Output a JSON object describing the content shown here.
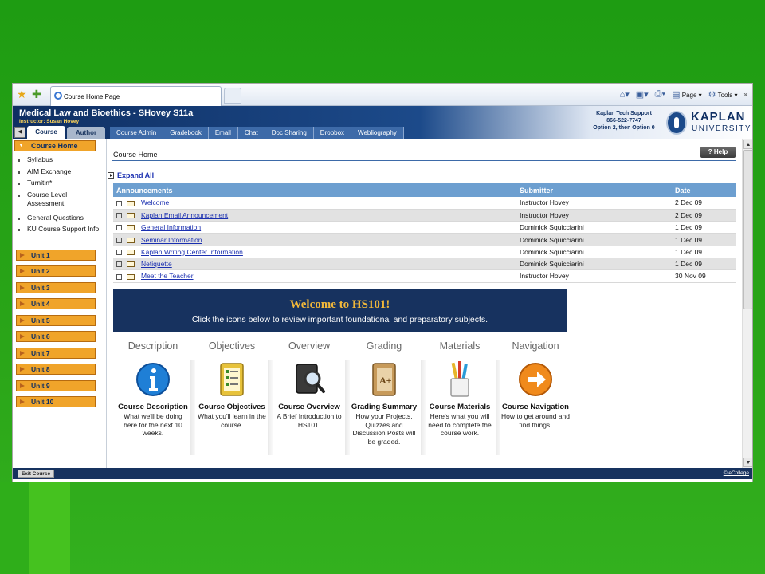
{
  "browser": {
    "tab_title": "Course Home Page",
    "tools": [
      "Page",
      "Tools"
    ]
  },
  "header": {
    "course_title": "Medical Law and Bioethics - SHovey S11a",
    "instructor": "Instructor: Susan Hovey",
    "tabs": [
      "Course",
      "Author"
    ],
    "nav": [
      "Course Admin",
      "Gradebook",
      "Email",
      "Chat",
      "Doc Sharing",
      "Dropbox",
      "Webliography"
    ],
    "support": [
      "Kaplan Tech Support",
      "866-522-7747",
      "Option 2, then Option 0"
    ],
    "logo": [
      "KAPLAN",
      "UNIVERSITY"
    ]
  },
  "sidebar": {
    "header": "Course Home",
    "links": [
      "Syllabus",
      "AIM Exchange",
      "Turnitin*",
      "Course Level Assessment",
      "General Questions",
      "KU Course Support Info"
    ],
    "units": [
      "Unit 1",
      "Unit 2",
      "Unit 3",
      "Unit 4",
      "Unit 5",
      "Unit 6",
      "Unit 7",
      "Unit 8",
      "Unit 9",
      "Unit 10"
    ]
  },
  "main": {
    "page_title": "Course Home",
    "help": "Help",
    "expand_all": "Expand All",
    "columns": [
      "Announcements",
      "Submitter",
      "Date"
    ],
    "announcements": [
      {
        "title": "Welcome",
        "submitter": "Instructor Hovey",
        "date": "2 Dec 09"
      },
      {
        "title": "Kaplan Email Announcement",
        "submitter": "Instructor Hovey",
        "date": "2 Dec 09"
      },
      {
        "title": "General Information",
        "submitter": "Dominick Squicciarini",
        "date": "1 Dec 09"
      },
      {
        "title": "Seminar Information",
        "submitter": "Dominick Squicciarini",
        "date": "1 Dec 09"
      },
      {
        "title": "Kaplan Writing Center Information",
        "submitter": "Dominick Squicciarini",
        "date": "1 Dec 09"
      },
      {
        "title": "Netiquette",
        "submitter": "Dominick Squicciarini",
        "date": "1 Dec 09"
      },
      {
        "title": "Meet the Teacher",
        "submitter": "Instructor Hovey",
        "date": "30 Nov 09"
      }
    ],
    "welcome_title": "Welcome to HS101!",
    "welcome_sub": "Click the icons below to review important foundational and preparatory subjects.",
    "cards": [
      {
        "head": "Description",
        "name": "Course Description",
        "desc": "What we'll be doing here for the next 10 weeks.",
        "icon": "info-icon"
      },
      {
        "head": "Objectives",
        "name": "Course Objectives",
        "desc": "What you'll learn in the course.",
        "icon": "notepad-icon"
      },
      {
        "head": "Overview",
        "name": "Course Overview",
        "desc": "A Brief Introduction to HS101.",
        "icon": "magnifier-book-icon"
      },
      {
        "head": "Grading",
        "name": "Grading Summary",
        "desc": "How your Projects, Quizzes and Discussion Posts will be graded.",
        "icon": "grade-notebook-icon"
      },
      {
        "head": "Materials",
        "name": "Course Materials",
        "desc": "Here's what you will need to complete the course work.",
        "icon": "pencil-cup-icon"
      },
      {
        "head": "Navigation",
        "name": "Course Navigation",
        "desc": "How to get around and find things.",
        "icon": "arrow-circle-icon"
      }
    ]
  },
  "footer": {
    "exit": "Exit Course",
    "brand": "© eCollege"
  },
  "colors": {
    "slide_green": "#2aa518",
    "navy": "#17325f",
    "orange": "#f0a42a",
    "table_header": "#6d9fd0",
    "link": "#1a2fb0"
  }
}
